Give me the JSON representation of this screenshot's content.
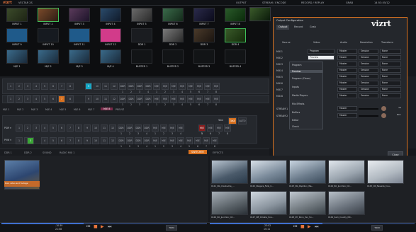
{
  "app": {
    "logo": "vizrt",
    "session": "VECTAR 2S",
    "menu": [
      "OUTPUT",
      "STREAM / ENCODE",
      "RECORD / REPLAY",
      "GRAB",
      "14:53:55/12"
    ],
    "brand_color": "#e8743b"
  },
  "monitors": {
    "row1": [
      "INPUT 1",
      "INPUT 2",
      "INPUT 3",
      "INPUT 4",
      "INPUT 5",
      "INPUT 6",
      "INPUT 7",
      "INPUT 8"
    ],
    "row2": [
      "INPUT 9",
      "INPUT 10",
      "INPUT 11",
      "INPUT 12",
      "DDR 1",
      "DDR 2",
      "DDR 3",
      "DDR 4"
    ],
    "row3": [
      "M/E 1",
      "M/E 2",
      "M/E 3",
      "M/E 4",
      "BUFFER 1",
      "BUFFER 2",
      "BUFFER 3",
      "BUFFER 4"
    ]
  },
  "switcher": {
    "row_buttons": [
      "1",
      "2",
      "3",
      "4",
      "5",
      "6",
      "7",
      "8",
      "9",
      "10",
      "11",
      "12",
      "DDR 1",
      "DDR 2",
      "DDR 3",
      "DDR 4",
      "M/E 1",
      "M/E 2",
      "M/E 3",
      "M/E 4",
      "M/E 5",
      "M/E 6",
      "M/E 7",
      "M/E 8"
    ],
    "me_tabs": [
      "M/E 1",
      "M/E 2",
      "M/E 3",
      "M/E 4",
      "M/E 5",
      "M/E 6",
      "M/E 7",
      "M/E 8",
      "PREVIZ"
    ],
    "me_active": "M/E 8",
    "program_label": "PGM ▾",
    "preview_label": "PVW ▾",
    "take_label": "TAKE",
    "auto_label": "AUTO",
    "take_label2": "Take"
  },
  "dialog": {
    "title": "Output Configuration",
    "tabs": [
      "Output",
      "Record",
      "Grab"
    ],
    "active_tab": "Output",
    "columns": [
      "Source",
      "Video",
      "Audio",
      "Resolution",
      "Transform"
    ],
    "rows": [
      {
        "name": "MIX 1",
        "video": "Program",
        "audio": "Master",
        "res": "Session",
        "tx": "None"
      },
      {
        "name": "MIX 2",
        "video": "Preview",
        "audio": "Master",
        "res": "Session",
        "tx": "None"
      },
      {
        "name": "MIX 3",
        "video": "Program",
        "audio": "Master",
        "res": "Session",
        "tx": "None"
      },
      {
        "name": "MIX 4",
        "video": "Program",
        "audio": "Master",
        "res": "Session",
        "tx": "None"
      },
      {
        "name": "MIX 5",
        "video": "Program",
        "audio": "Master",
        "res": "Session",
        "tx": "None"
      },
      {
        "name": "MIX 6",
        "video": "Program",
        "audio": "Master",
        "res": "Session",
        "tx": "None"
      },
      {
        "name": "MIX 7",
        "video": "Program",
        "audio": "Master",
        "res": "Session",
        "tx": "None"
      },
      {
        "name": "MIX 8",
        "video": "Program",
        "audio": "Master",
        "res": "Session",
        "tx": "None"
      }
    ],
    "stream_rows": [
      {
        "name": "STREAM 1",
        "video": "Program",
        "audio": "Master"
      },
      {
        "name": "STREAM 2",
        "video": "Program",
        "audio": "Master"
      }
    ],
    "dropdown": [
      "Program",
      "Preview",
      "Program (Clean)",
      "Inputs",
      "Media Players",
      "Mix Effects",
      "Buffers",
      "Editor",
      "Check"
    ],
    "dropdown_selected": "Preview",
    "close_label": "Close",
    "side_labels": [
      "3G",
      "NDI"
    ]
  },
  "bottom_tabs": [
    "DDR 1",
    "DDR 2",
    "SOUND",
    "RADIO MIX 1",
    "SWITCHER",
    "EFFECTS"
  ],
  "bottom_active": "SWITCHER",
  "bin_left": {
    "clip_label": "Pure video and footage"
  },
  "bin_right": {
    "thumbs": [
      {
        "label": "0121_NG_Clarksville_..."
      },
      {
        "label": "0122_Niagara_Falls_C..."
      },
      {
        "label": "0123_NG_Papillion_Wa..."
      },
      {
        "label": "0124_RK_Junction_Cit..."
      },
      {
        "label": "0125_CN_Nevada_Cou..."
      },
      {
        "label": "0126_RK_Junction_Cit..."
      },
      {
        "label": "0127_NE_Omaha_Sno..."
      },
      {
        "label": "0128_NY_Penn_Yan_Sn..."
      },
      {
        "label": "0129_Sam_County_Mil..."
      }
    ]
  },
  "transport": {
    "left_time": "-10:39",
    "left_total": "21:08",
    "right_time": "-23:02",
    "right_total": "15:11",
    "trim_label": "TRIM",
    "trim_label2": "TRIM",
    "progress_left": 0.4,
    "progress_right": 0.55
  }
}
